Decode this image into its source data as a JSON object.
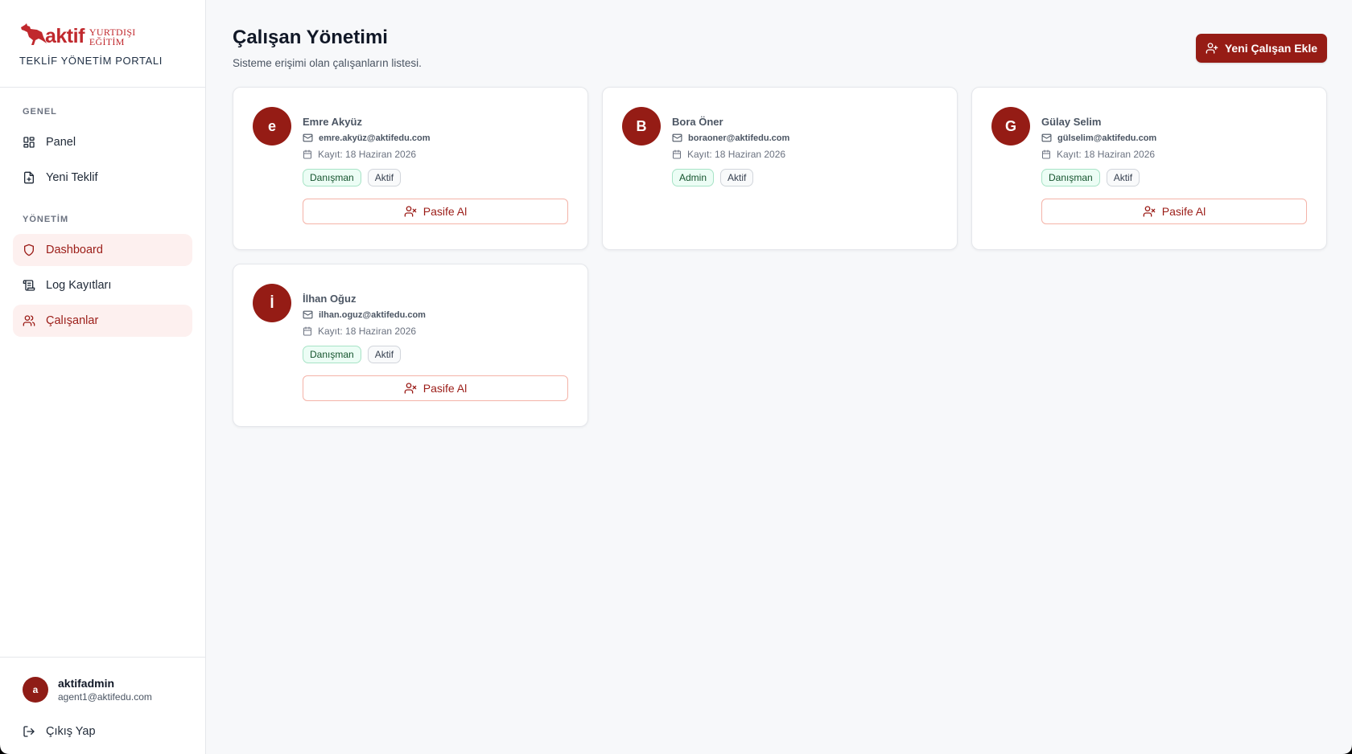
{
  "brand": {
    "logo_word": "aktif",
    "logo_right_top": "YURTDIŞI",
    "logo_right_bottom": "EĞİTİM",
    "portal_name": "TEKLİF YÖNETİM PORTALI",
    "accent_color": "#c0282d"
  },
  "sidebar": {
    "sections": [
      {
        "title": "GENEL",
        "items": [
          {
            "label": "Panel",
            "icon": "grid-icon",
            "active": false
          },
          {
            "label": "Yeni Teklif",
            "icon": "file-plus-icon",
            "active": false
          }
        ]
      },
      {
        "title": "YÖNETİM",
        "items": [
          {
            "label": "Dashboard",
            "icon": "shield-icon",
            "active": true
          },
          {
            "label": "Log Kayıtları",
            "icon": "scroll-icon",
            "active": false
          },
          {
            "label": "Çalışanlar",
            "icon": "users-icon",
            "active": true
          }
        ]
      }
    ],
    "user": {
      "initial": "a",
      "name": "aktifadmin",
      "email": "agent1@aktifedu.com"
    },
    "logout_label": "Çıkış Yap"
  },
  "main": {
    "title": "Çalışan Yönetimi",
    "subtitle": "Sisteme erişimi olan çalışanların listesi.",
    "add_button_label": "Yeni Çalışan Ekle"
  },
  "employees": [
    {
      "initial": "e",
      "name": "Emre Akyüz",
      "email": "emre.akyüz@aktifedu.com",
      "date": "Kayıt: 18 Haziran 2026",
      "role": "Danışman",
      "status": "Aktif",
      "action": "Pasife Al"
    },
    {
      "initial": "B",
      "name": "Bora Öner",
      "email": "boraoner@aktifedu.com",
      "date": "Kayıt: 18 Haziran 2026",
      "role": "Admin",
      "status": "Aktif",
      "action": ""
    },
    {
      "initial": "G",
      "name": "Gülay Selim",
      "email": "gülselim@aktifedu.com",
      "date": "Kayıt: 18 Haziran 2026",
      "role": "Danışman",
      "status": "Aktif",
      "action": "Pasife Al"
    },
    {
      "initial": "İ",
      "name": "İlhan Oğuz",
      "email": "ilhan.oguz@aktifedu.com",
      "date": "Kayıt: 18 Haziran 2026",
      "role": "Danışman",
      "status": "Aktif",
      "action": "Pasife Al"
    }
  ],
  "colors": {
    "primary": "#961c15",
    "active_bg": "#fdf0ef",
    "role_badge_bg": "#ecfdf5"
  }
}
